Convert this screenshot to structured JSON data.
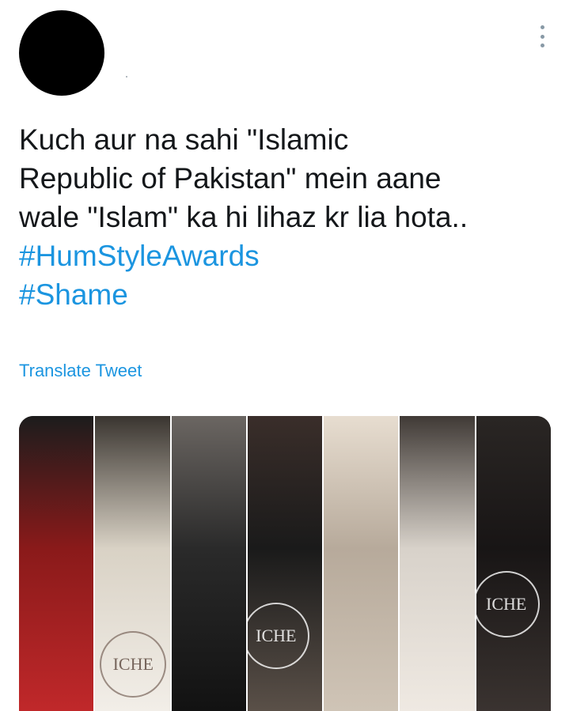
{
  "tweet": {
    "lines": [
      "Kuch aur na sahi \"Islamic",
      "Republic of Pakistan\" mein aane",
      "wale \"Islam\" ka hi lihaz kr lia hota.."
    ],
    "hashtags": [
      "#HumStyleAwards",
      "#Shame"
    ],
    "translate_label": "Translate Tweet"
  },
  "header": {
    "avatar_icon": "avatar-placeholder",
    "menu_icon": "more-vertical-icon"
  },
  "media": {
    "watermark_text": "ICHE",
    "panels": [
      {
        "name": "red-gown",
        "colors": [
          "#1c1c1c",
          "#8a1a1a",
          "#c0282a"
        ]
      },
      {
        "name": "white-gown-back",
        "colors": [
          "#3a3530",
          "#d9d2c5",
          "#f2eee8"
        ]
      },
      {
        "name": "black-gown",
        "colors": [
          "#6b6662",
          "#2a2a2a",
          "#121212"
        ]
      },
      {
        "name": "black-sequin",
        "colors": [
          "#3a2e2a",
          "#1a1a1a",
          "#5a5048"
        ]
      },
      {
        "name": "silver-gown",
        "colors": [
          "#e7ddd0",
          "#b7aa9b",
          "#cfc4b6"
        ]
      },
      {
        "name": "white-drape",
        "colors": [
          "#403a36",
          "#d8d2ca",
          "#efe9e2"
        ]
      },
      {
        "name": "black-lace",
        "colors": [
          "#2a2624",
          "#181515",
          "#3a3330"
        ]
      }
    ]
  }
}
